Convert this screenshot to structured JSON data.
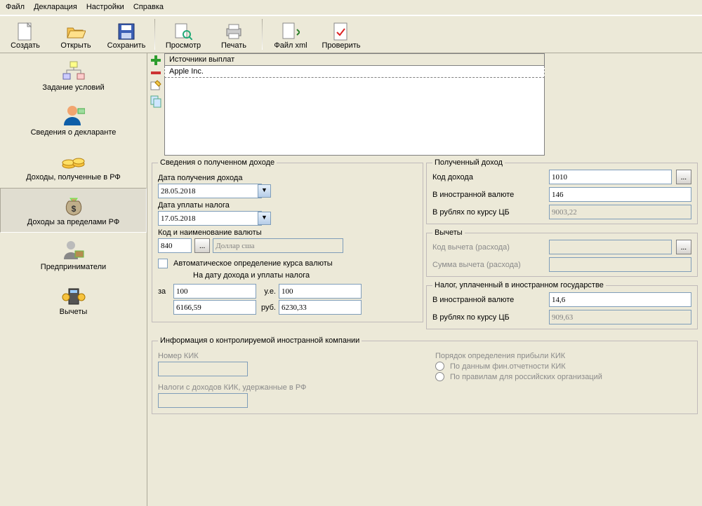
{
  "menubar": [
    "Файл",
    "Декларация",
    "Настройки",
    "Справка"
  ],
  "toolbar": {
    "create": "Создать",
    "open": "Открыть",
    "save": "Сохранить",
    "preview": "Просмотр",
    "print": "Печать",
    "filexml": "Файл xml",
    "check": "Проверить"
  },
  "side": {
    "cond": "Задание условий",
    "decl": "Сведения о декларанте",
    "rf": "Доходы, полученные в РФ",
    "abroad": "Доходы за пределами РФ",
    "entr": "Предприниматели",
    "ded": "Вычеты"
  },
  "sources": {
    "header": "Источники выплат",
    "row0": "Apple Inc."
  },
  "left": {
    "legend": "Сведения о полученном доходе",
    "date_recv_lbl": "Дата получения дохода",
    "date_recv": "28.05.2018",
    "date_tax_lbl": "Дата уплаты налога",
    "date_tax": "17.05.2018",
    "cur_lbl": "Код и наименование валюты",
    "cur_code": "840",
    "cur_name": "Доллар сша",
    "auto": "Автоматическое определение курса валюты",
    "ondate": "На дату дохода и уплаты налога",
    "za": "за",
    "ue": "у.е.",
    "rub": "руб.",
    "rate1": "100",
    "rate1u": "100",
    "rate2": "6166,59",
    "rate2r": "6230,33"
  },
  "right": {
    "inc_legend": "Полученный доход",
    "code_lbl": "Код дохода",
    "code": "1010",
    "fc_lbl": "В иностранной валюте",
    "fc": "146",
    "rub_lbl": "В рублях по курсу ЦБ",
    "rub": "9003,22",
    "ded_legend": "Вычеты",
    "dcode_lbl": "Код вычета (расхода)",
    "dcode": "",
    "dsum_lbl": "Сумма вычета (расхода)",
    "dsum": "",
    "tax_legend": "Налог, уплаченный в иностранном государстве",
    "tfc_lbl": "В иностранной валюте",
    "tfc": "14,6",
    "trub_lbl": "В рублях по курсу ЦБ",
    "trub": "909,63"
  },
  "cfc": {
    "legend": "Информация о контролируемой иностранной компании",
    "num": "Номер КИК",
    "tax": "Налоги с доходов КИК, удержанные в РФ",
    "order": "Порядок определения прибыли КИК",
    "r1": "По данным фин.отчетности КИК",
    "r2": "По правилам для российских организаций"
  },
  "dots": "..."
}
